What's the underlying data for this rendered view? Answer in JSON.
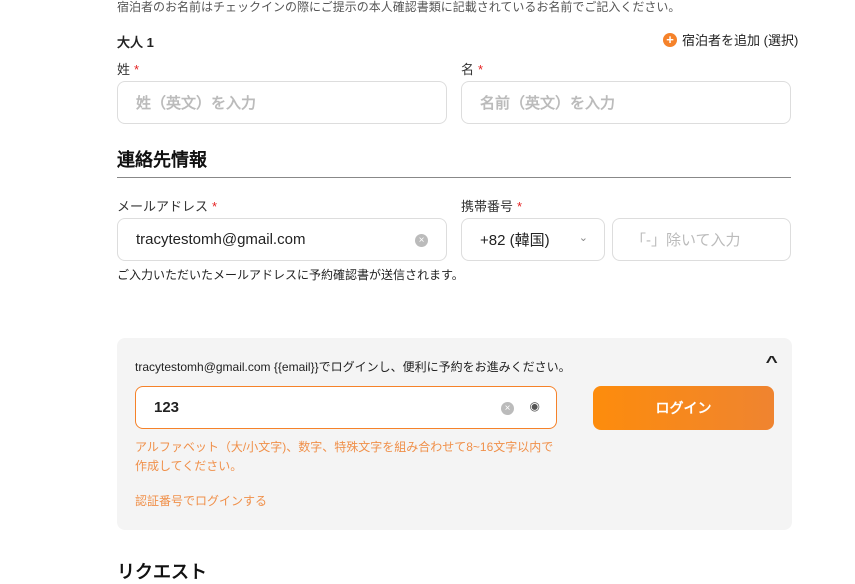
{
  "guest_note": "宿泊者のお名前はチェックインの際にご提示の本人確認書類に記載されているお名前でご記入ください。",
  "adult_title": "大人 1",
  "add_guest": "宿泊者を追加 (選択)",
  "last_name": {
    "label": "姓",
    "required": "*",
    "placeholder": "姓（英文）を入力"
  },
  "first_name": {
    "label": "名",
    "required": "*",
    "placeholder": "名前（英文）を入力"
  },
  "contact_title": "連絡先情報",
  "email": {
    "label": "メールアドレス",
    "required": "*",
    "value": "tracytestomh@gmail.com",
    "note": "ご入力いただいたメールアドレスに予約確認書が送信されます。"
  },
  "phone": {
    "label": "携帯番号",
    "required": "*",
    "country": "+82 (韓国)",
    "placeholder": "「-」除いて入力"
  },
  "login": {
    "message": "tracytestomh@gmail.com {{email}}でログインし、便利に予約をお進みください。",
    "password": "123",
    "button": "ログイン",
    "error": "アルファベット（大/小文字)、数字、特殊文字を組み合わせて8~16文字以内で作成してください。",
    "alt_link": "認証番号でログインする"
  },
  "request_title": "リクエスト",
  "colors": {
    "accent": "#f5822a",
    "error": "#f0904a",
    "required": "#e52222"
  }
}
